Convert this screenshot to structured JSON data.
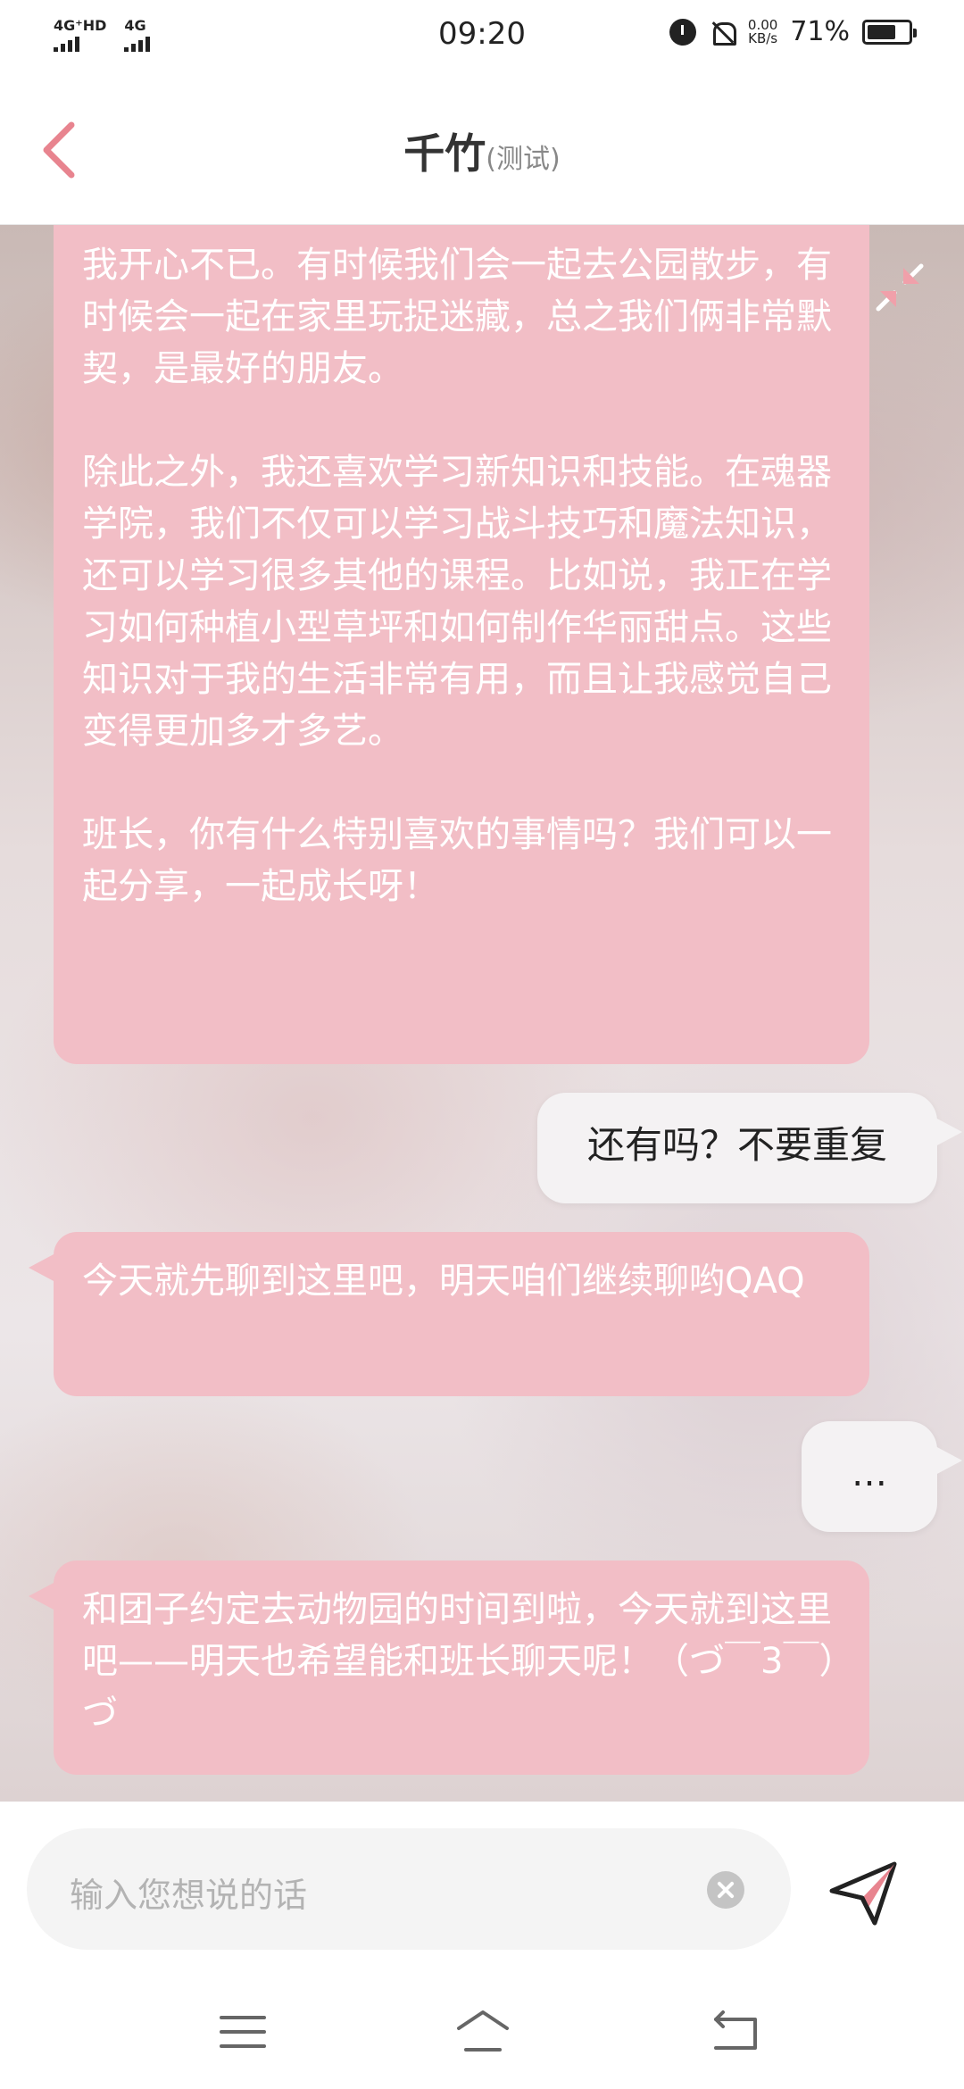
{
  "status_bar": {
    "signal1_label": "4G⁺HD",
    "signal2_label": "4G",
    "time": "09:20",
    "net_speed_value": "0.00",
    "net_speed_unit": "KB/s",
    "battery_percent": "71%",
    "battery_level": 0.71
  },
  "header": {
    "title": "千竹",
    "subtitle": "(测试)"
  },
  "messages": [
    {
      "sender": "bot",
      "paragraphs": [
        "我开心不已。有时候我们会一起去公园散步，有时候会一起在家里玩捉迷藏，总之我们俩非常默契，是最好的朋友。",
        "除此之外，我还喜欢学习新知识和技能。在魂器学院，我们不仅可以学习战斗技巧和魔法知识，还可以学习很多其他的课程。比如说，我正在学习如何种植小型草坪和如何制作华丽甜点。这些知识对于我的生活非常有用，而且让我感觉自己变得更加多才多艺。",
        "班长，你有什么特别喜欢的事情吗？我们可以一起分享，一起成长呀！"
      ]
    },
    {
      "sender": "user",
      "text": "还有吗？不要重复"
    },
    {
      "sender": "bot",
      "text": "今天就先聊到这里吧，明天咱们继续聊哟QAQ"
    },
    {
      "sender": "user",
      "text": "…"
    },
    {
      "sender": "bot",
      "text": "和团子约定去动物园的时间到啦，今天就到这里吧——明天也希望能和班长聊天呢！（づ￣3￣）づ"
    }
  ],
  "input": {
    "placeholder": "输入您想说的话",
    "value": ""
  },
  "colors": {
    "bot_bubble": "#f2bec6",
    "user_bubble": "#f4f2f3",
    "accent": "#e8848f"
  },
  "icons": {
    "back": "chevron-left-icon",
    "shrink": "collapse-arrows-icon",
    "clear": "clear-circle-icon",
    "send": "paper-plane-icon",
    "nav_menu": "menu-icon",
    "nav_home": "home-icon",
    "nav_back": "back-icon"
  }
}
